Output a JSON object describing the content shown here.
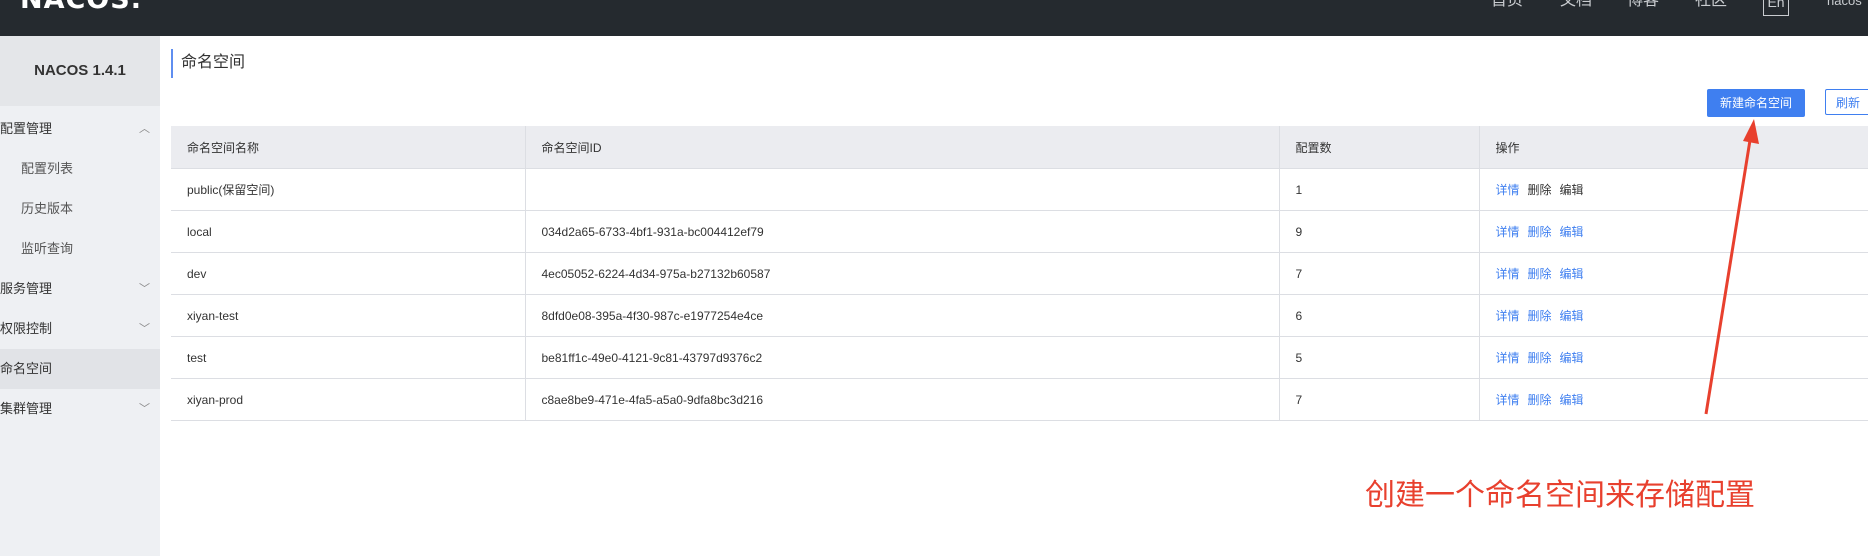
{
  "header": {
    "logo_text": "NACOS.",
    "nav": [
      "首页",
      "文档",
      "博客",
      "社区"
    ],
    "lang": "En",
    "user": "nacos"
  },
  "sidebar": {
    "version": "NACOS 1.4.1",
    "groups": [
      {
        "label": "配置管理",
        "expanded": true,
        "items": [
          "配置列表",
          "历史版本",
          "监听查询"
        ]
      },
      {
        "label": "服务管理",
        "expanded": false
      },
      {
        "label": "权限控制",
        "expanded": false
      },
      {
        "label": "命名空间",
        "active": true
      },
      {
        "label": "集群管理",
        "expanded": false
      }
    ]
  },
  "page": {
    "title": "命名空间",
    "new_button": "新建命名空间",
    "refresh_button": "刷新"
  },
  "table": {
    "columns": [
      "命名空间名称",
      "命名空间ID",
      "配置数",
      "操作"
    ],
    "rows": [
      {
        "name": "public(保留空间)",
        "id": "",
        "count": "1"
      },
      {
        "name": "local",
        "id": "034d2a65-6733-4bf1-931a-bc004412ef79",
        "count": "9"
      },
      {
        "name": "dev",
        "id": "4ec05052-6224-4d34-975a-b27132b60587",
        "count": "7"
      },
      {
        "name": "xiyan-test",
        "id": "8dfd0e08-395a-4f30-987c-e1977254e4ce",
        "count": "6"
      },
      {
        "name": "test",
        "id": "be81ff1c-49e0-4121-9c81-43797d9376c2",
        "count": "5"
      },
      {
        "name": "xiyan-prod",
        "id": "c8ae8be9-471e-4fa5-a5a0-9dfa8bc3d216",
        "count": "7"
      }
    ],
    "actions": {
      "detail": "详情",
      "delete": "删除",
      "edit": "编辑"
    }
  },
  "annotation": {
    "text": "创建一个命名空间来存储配置",
    "color": "#e8402e"
  },
  "colors": {
    "accent": "#3f7ff0",
    "topbar": "#252a2f",
    "sidebar": "#eef0f3"
  }
}
